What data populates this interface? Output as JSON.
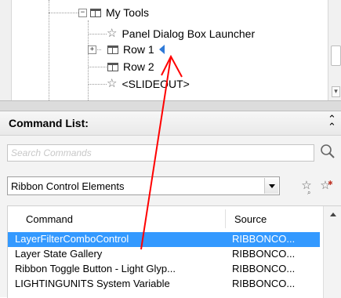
{
  "tree": {
    "items": [
      {
        "label": "My Tools",
        "icon": "panel-icon",
        "expander": "−"
      },
      {
        "label": "Panel Dialog Box Launcher",
        "icon": "star-icon"
      },
      {
        "label": "Row 1",
        "icon": "panel-icon",
        "expander": "+"
      },
      {
        "label": "Row 2",
        "icon": "panel-icon"
      },
      {
        "label": "<SLIDEOUT>",
        "icon": "star-icon"
      }
    ],
    "scroll_arrow": "▾"
  },
  "command_list": {
    "title": "Command List:",
    "collapse_glyph": "⌃",
    "search": {
      "placeholder": "Search Commands",
      "value": ""
    },
    "filter": {
      "selected": "Ribbon Control Elements"
    },
    "table": {
      "columns": [
        "Command",
        "Source"
      ],
      "rows": [
        {
          "command": "LayerFilterComboControl",
          "source": "RIBBONCO...",
          "selected": true
        },
        {
          "command": "Layer State Gallery",
          "source": "RIBBONCO...",
          "selected": false
        },
        {
          "command": "Ribbon Toggle Button - Light Glyp...",
          "source": "RIBBONCO...",
          "selected": false
        },
        {
          "command": "LIGHTINGUNITS System Variable",
          "source": "RIBBONCO...",
          "selected": false
        }
      ]
    }
  },
  "colors": {
    "selection": "#3399ff",
    "annotation": "#ff0000",
    "marker": "#2f7ad8"
  },
  "icons": [
    "panel-icon",
    "star-icon",
    "search-icon",
    "find-command-icon",
    "new-command-icon",
    "collapse-icon"
  ]
}
